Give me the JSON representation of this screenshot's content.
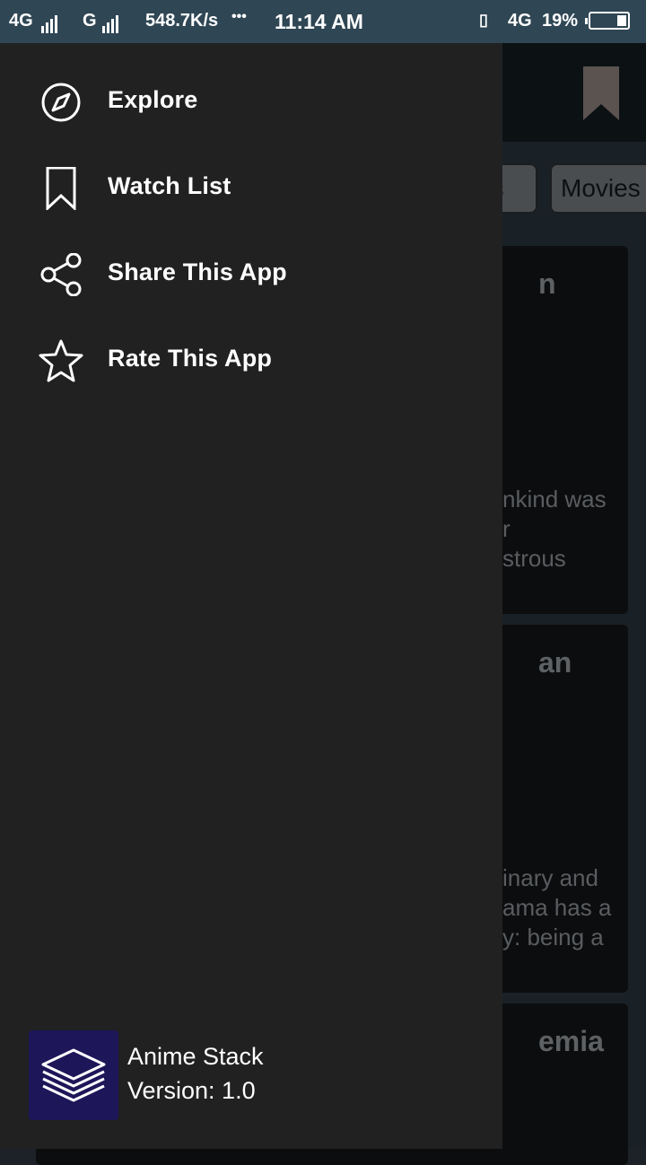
{
  "status_bar": {
    "network1": "4G",
    "network2": "G",
    "speed": "548.7K/s",
    "more": "•••",
    "time": "11:14 AM",
    "network3": "4G",
    "battery": "19%",
    "battery_level": 0.19
  },
  "background": {
    "chips": [
      "es",
      "Movies"
    ],
    "cards": [
      {
        "title_fragment": "n",
        "desc_lines": [
          "nkind was",
          "r",
          "strous"
        ]
      },
      {
        "title_fragment": "an",
        "desc_lines": [
          "inary and",
          "ama has a",
          "y: being a"
        ]
      },
      {
        "title_fragment": "emia",
        "desc_lines": []
      }
    ]
  },
  "drawer": {
    "items": [
      {
        "label": "Explore",
        "icon": "compass-icon"
      },
      {
        "label": "Watch List",
        "icon": "bookmark-icon"
      },
      {
        "label": "Share This App",
        "icon": "share-icon"
      },
      {
        "label": "Rate This App",
        "icon": "star-icon"
      }
    ],
    "footer": {
      "app_name": "Anime Stack",
      "version": "Version: 1.0",
      "logo_color": "#1d1659"
    }
  },
  "colors": {
    "status_bar": "#2f4654",
    "drawer_bg": "#212121",
    "toolbar_bg": "#0c1114"
  }
}
